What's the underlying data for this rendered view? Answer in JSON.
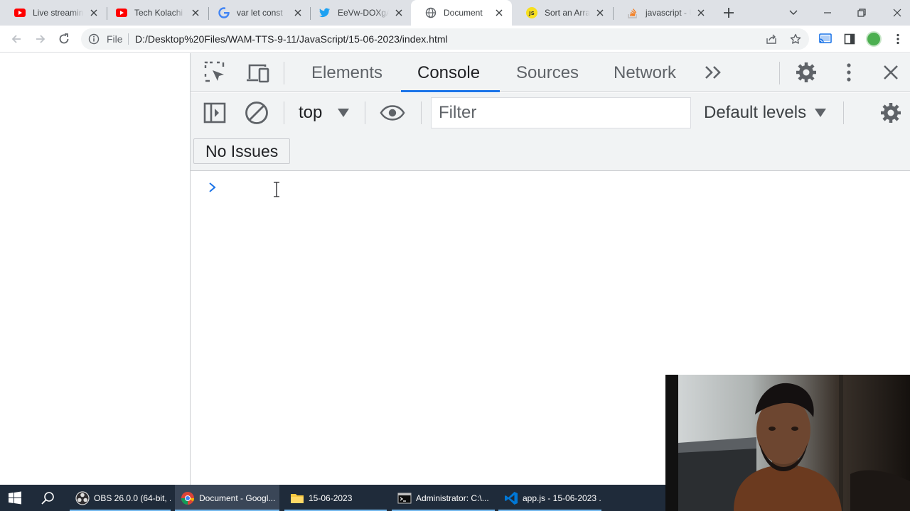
{
  "browser": {
    "tabs": [
      {
        "title": "Live streaming",
        "icon": "youtube-icon",
        "color": "#ff0000"
      },
      {
        "title": "Tech Kolachi",
        "icon": "youtube-icon",
        "color": "#ff0000"
      },
      {
        "title": "var let const",
        "icon": "google-icon",
        "color": "#4285f4"
      },
      {
        "title": "EeVw-DOXgA",
        "icon": "twitter-icon",
        "color": "#1da1f2"
      },
      {
        "title": "Document",
        "icon": "globe-icon",
        "color": "#5f6368",
        "active": true
      },
      {
        "title": "Sort an Array",
        "icon": "js-icon",
        "color": "#f7df1e"
      },
      {
        "title": "javascript - U",
        "icon": "stackoverflow-icon",
        "color": "#f48024"
      }
    ],
    "address": {
      "scheme_label": "File",
      "url": "D:/Desktop%20Files/WAM-TTS-9-11/JavaScript/15-06-2023/index.html"
    }
  },
  "devtools": {
    "tabs": [
      {
        "label": "Elements"
      },
      {
        "label": "Console",
        "active": true
      },
      {
        "label": "Sources"
      },
      {
        "label": "Network"
      }
    ],
    "console": {
      "context": "top",
      "filter_placeholder": "Filter",
      "levels": "Default levels",
      "issues": "No Issues"
    },
    "accent_color": "#1a73e8"
  },
  "taskbar": {
    "items": [
      {
        "label": "OBS 26.0.0 (64-bit, ...",
        "icon": "obs-icon"
      },
      {
        "label": "Document - Googl...",
        "icon": "chrome-icon",
        "active": true
      },
      {
        "label": "15-06-2023",
        "icon": "folder-icon"
      },
      {
        "label": "Administrator: C:\\...",
        "icon": "terminal-icon"
      },
      {
        "label": "app.js - 15-06-2023 ...",
        "icon": "vscode-icon"
      }
    ]
  }
}
